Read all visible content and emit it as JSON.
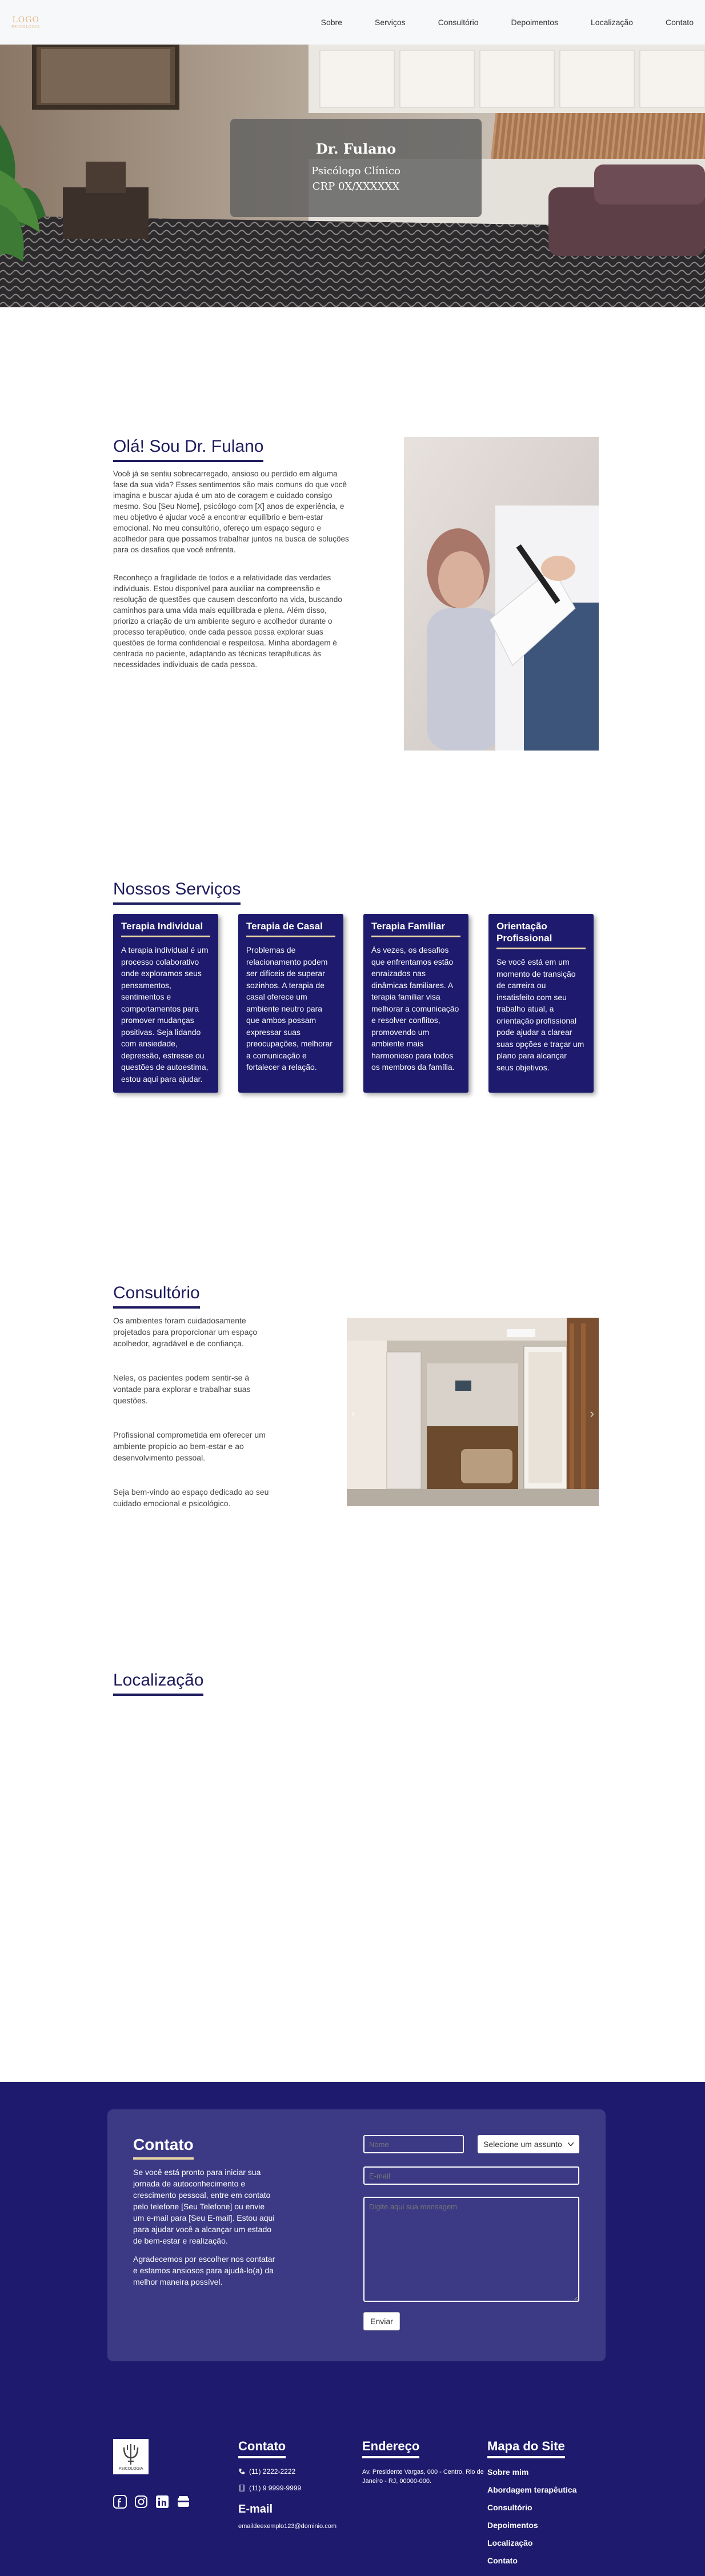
{
  "nav": {
    "logo_line1": "LOGO",
    "logo_line2": "PSICOLOGIA",
    "items": [
      "Sobre",
      "Serviços",
      "Consultório",
      "Depoimentos",
      "Localização",
      "Contato"
    ]
  },
  "hero": {
    "name": "Dr. Fulano",
    "title": "Psicólogo Clínico",
    "crp": "CRP 0X/XXXXXX"
  },
  "about": {
    "heading": "Olá! Sou Dr. Fulano",
    "p1": "Você já se sentiu sobrecarregado, ansioso ou perdido em alguma fase da sua vida? Esses sentimentos são mais comuns do que você imagina e buscar ajuda é um ato de coragem e cuidado consigo mesmo. Sou [Seu Nome], psicólogo com [X] anos de experiência, e meu objetivo é ajudar você a encontrar equilíbrio e bem-estar emocional. No meu consultório, ofereço um espaço seguro e acolhedor para que possamos trabalhar juntos na busca de soluções para os desafios que você enfrenta.",
    "p2": "Reconheço a fragilidade de todos e a relatividade das verdades individuais. Estou disponível para auxiliar na compreensão e resolução de questões que causem desconforto na vida, buscando caminhos para uma vida mais equilibrada e plena. Além disso, priorizo a criação de um ambiente seguro e acolhedor durante o processo terapêutico, onde cada pessoa possa explorar suas questões de forma confidencial e respeitosa. Minha abordagem é centrada no paciente, adaptando as técnicas terapêuticas às necessidades individuais de cada pessoa."
  },
  "services": {
    "heading": "Nossos Serviços",
    "cards": [
      {
        "title": "Terapia Individual",
        "text": "A terapia individual é um processo colaborativo onde exploramos seus pensamentos, sentimentos e comportamentos para promover mudanças positivas. Seja lidando com ansiedade, depressão, estresse ou questões de autoestima, estou aqui para ajudar."
      },
      {
        "title": "Terapia de Casal",
        "text": "Problemas de relacionamento podem ser difíceis de superar sozinhos. A terapia de casal oferece um ambiente neutro para que ambos possam expressar suas preocupações, melhorar a comunicação e fortalecer a relação."
      },
      {
        "title": "Terapia Familiar",
        "text": "Às vezes, os desafios que enfrentamos estão enraizados nas dinâmicas familiares. A terapia familiar visa melhorar a comunicação e resolver conflitos, promovendo um ambiente mais harmonioso para todos os membros da família."
      },
      {
        "title": "Orientação Profissional",
        "text": "Se você está em um momento de transição de carreira ou insatisfeito com seu trabalho atual, a orientação profissional pode ajudar a clarear suas opções e traçar um plano para alcançar seus objetivos."
      }
    ]
  },
  "office": {
    "heading": "Consultório",
    "paragraphs": [
      "Os ambientes foram cuidadosamente projetados para proporcionar um espaço acolhedor, agradável e de confiança.",
      "Neles, os pacientes podem sentir-se à vontade para explorar e trabalhar suas questões.",
      "Profissional comprometida em oferecer um ambiente propício ao bem-estar e ao desenvolvimento pessoal.",
      "Seja bem-vindo ao espaço dedicado ao seu cuidado emocional e psicológico."
    ],
    "prev_arrow": "‹",
    "next_arrow": "›"
  },
  "location": {
    "heading": "Localização"
  },
  "contact": {
    "heading": "Contato",
    "p1": "Se você está pronto para iniciar sua jornada de autoconhecimento e crescimento pessoal, entre em contato pelo telefone [Seu Telefone] ou envie um e-mail para [Seu E-mail]. Estou aqui para ajudar você a alcançar um estado de bem-estar e realização.",
    "p2": "Agradecemos por escolher nos contatar e estamos ansiosos para ajudá-lo(a) da melhor maneira possível.",
    "name_placeholder": "Nome",
    "select_value": "Selecione um assunto",
    "email_placeholder": "E-mail",
    "message_placeholder": "Digite aqui sua mensagem",
    "submit": "Enviar"
  },
  "footer": {
    "logo_caption": "PSICOLOGIA",
    "contact_heading": "Contato",
    "phone1": "(11) 2222-2222",
    "phone2": "(11) 9 9999-9999",
    "email_heading": "E-mail",
    "email": "emaildeexemplo123@dominio.com",
    "address_heading": "Endereço",
    "address": "Av. Presidente Vargas, 000 - Centro, Rio de Janeiro - RJ, 00000-000.",
    "sitemap_heading": "Mapa do Site",
    "sitemap": [
      "Sobre mim",
      "Abordagem terapêutica",
      "Consultório",
      "Depoimentos",
      "Localização",
      "Contato"
    ]
  },
  "colors": {
    "brand_navy": "#1e1b6e",
    "accent_gold": "#ecd7a6"
  }
}
